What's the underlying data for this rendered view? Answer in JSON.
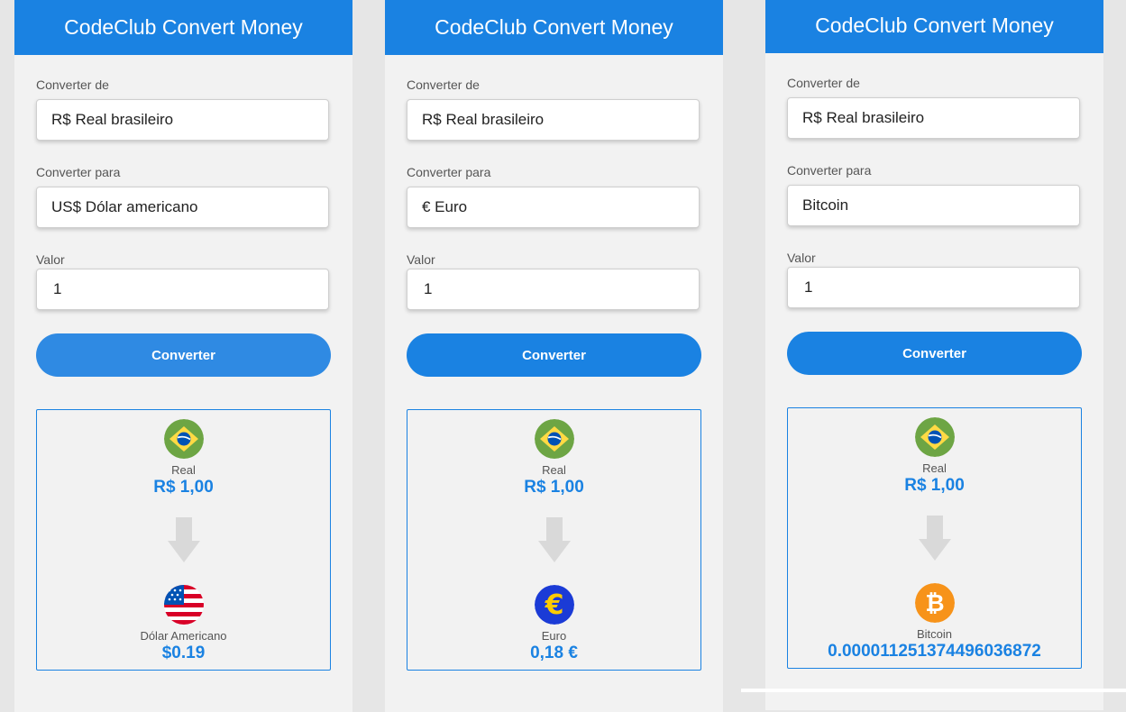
{
  "colors": {
    "accent": "#1a82e2",
    "panel_bg": "#f2f2f2",
    "page_bg": "#e6e6e6"
  },
  "panels": [
    {
      "title": "CodeClub Convert Money",
      "from_label": "Converter de",
      "from_value": "R$ Real brasileiro",
      "to_label": "Converter para",
      "to_value": "US$ Dólar americano",
      "amount_label": "Valor",
      "amount_value": "1",
      "button": "Converter",
      "from_name": "Real",
      "from_amount": "R$ 1,00",
      "from_icon": "brazil-flag-icon",
      "to_name": "Dólar Americano",
      "to_amount": "$0.19",
      "to_icon": "usa-flag-icon"
    },
    {
      "title": "CodeClub Convert Money",
      "from_label": "Converter de",
      "from_value": "R$ Real brasileiro",
      "to_label": "Converter para",
      "to_value": "€ Euro",
      "amount_label": "Valor",
      "amount_value": "1",
      "button": "Converter",
      "from_name": "Real",
      "from_amount": "R$ 1,00",
      "from_icon": "brazil-flag-icon",
      "to_name": "Euro",
      "to_amount": "0,18 €",
      "to_icon": "euro-icon"
    },
    {
      "title": "CodeClub Convert Money",
      "from_label": "Converter de",
      "from_value": "R$ Real brasileiro",
      "to_label": "Converter para",
      "to_value": "Bitcoin",
      "amount_label": "Valor",
      "amount_value": "1",
      "button": "Converter",
      "from_name": "Real",
      "from_amount": "R$ 1,00",
      "from_icon": "brazil-flag-icon",
      "to_name": "Bitcoin",
      "to_amount": "0.000011251374496036872",
      "to_icon": "bitcoin-icon"
    }
  ]
}
